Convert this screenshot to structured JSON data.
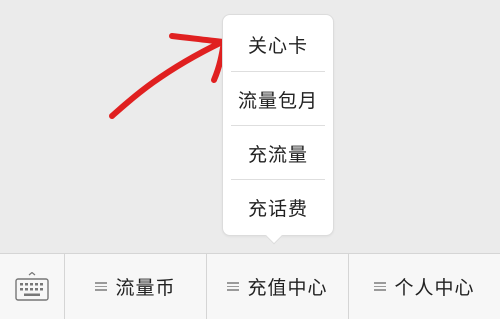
{
  "popup": {
    "items": [
      {
        "label": "关心卡"
      },
      {
        "label": "流量包月"
      },
      {
        "label": "充流量"
      },
      {
        "label": "充话费"
      }
    ]
  },
  "menubar": {
    "keyboard_icon": "keyboard-icon",
    "items": [
      {
        "label": "流量币",
        "icon": "menu-lines-icon"
      },
      {
        "label": "充值中心",
        "icon": "menu-lines-icon"
      },
      {
        "label": "个人中心",
        "icon": "menu-lines-icon"
      }
    ]
  },
  "annotation": {
    "color": "#e02020"
  }
}
